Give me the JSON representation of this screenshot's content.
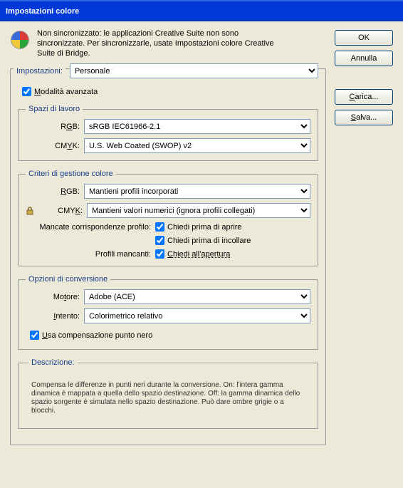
{
  "window": {
    "title": "Impostazioni colore"
  },
  "buttons": {
    "ok": "OK",
    "cancel": "Annulla",
    "load": "Carica...",
    "save": "Salva..."
  },
  "sync": {
    "text": "Non sincronizzato: le applicazioni Creative Suite non sono sincronizzate. Per sincronizzarle, usate Impostazioni colore Creative Suite di Bridge."
  },
  "settings": {
    "label": "Impostazioni:",
    "value": "Personale"
  },
  "advanced": {
    "label": "Modalità avanzata"
  },
  "workspace": {
    "legend": "Spazi di lavoro",
    "rgb_label": "RGB:",
    "rgb_value": "sRGB IEC61966-2.1",
    "cmyk_label": "CMYK:",
    "cmyk_value": "U.S. Web Coated (SWOP) v2"
  },
  "policies": {
    "legend": "Criteri di gestione colore",
    "rgb_label": "RGB:",
    "rgb_value": "Mantieni profili incorporati",
    "cmyk_label": "CMYK:",
    "cmyk_value": "Mantieni valori numerici (ignora profili collegati)",
    "mismatch_label": "Mancate corrispondenze profilo:",
    "ask_open": "Chiedi prima di aprire",
    "ask_paste": "Chiedi prima di incollare",
    "missing_label": "Profili mancanti:",
    "ask_missing": "Chiedi all'apertura"
  },
  "conversion": {
    "legend": "Opzioni di conversione",
    "engine_label": "Motore:",
    "engine_value": "Adobe (ACE)",
    "intent_label": "Intento:",
    "intent_value": "Colorimetrico relativo",
    "bpc": "Usa compensazione punto nero"
  },
  "description": {
    "legend": "Descrizione:",
    "text": "Compensa le differenze in punti neri durante la conversione. On: l'intera gamma dinamica è mappata a quella dello spazio destinazione. Off: la gamma dinamica dello spazio sorgente è simulata nello spazio destinazione. Può dare ombre grigie o a blocchi."
  }
}
